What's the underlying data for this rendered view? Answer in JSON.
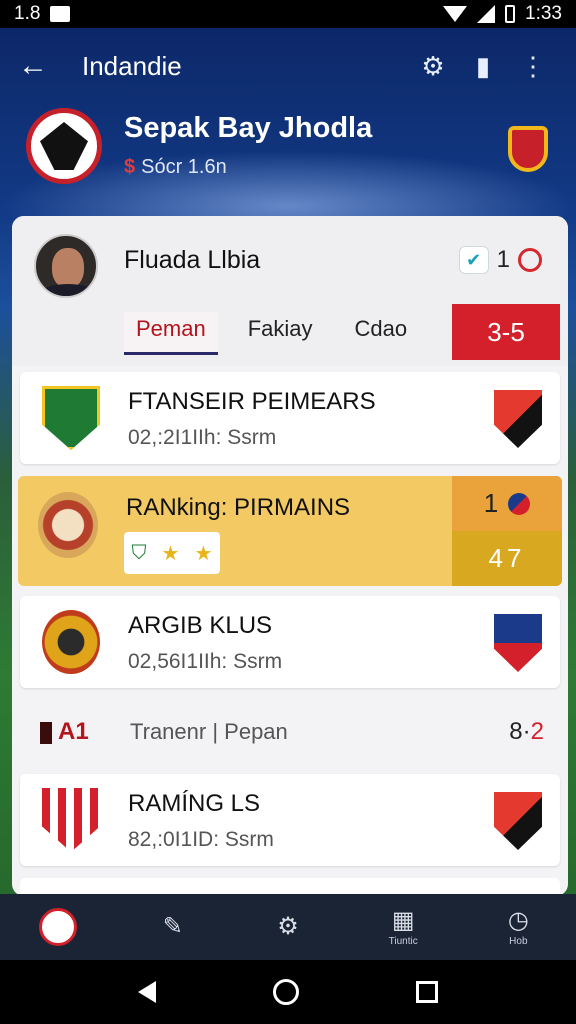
{
  "status_bar": {
    "left_text": "1.8",
    "time": "1:33"
  },
  "app_bar": {
    "title": "Indandie",
    "icons": [
      "back-arrow-icon",
      "gear-icon",
      "cards-icon",
      "more-vert-icon"
    ]
  },
  "club": {
    "name": "Sepak Bay Jhodla",
    "subtitle": "Sócr 1.6n",
    "currency_symbol": "$"
  },
  "profile": {
    "name": "Fluada Llbia",
    "stat_value": "1",
    "tabs": [
      {
        "label": "Peman",
        "active": true
      },
      {
        "label": "Fakiay",
        "active": false
      },
      {
        "label": "Cdao",
        "active": false
      }
    ],
    "score": "3-5"
  },
  "rows": [
    {
      "title": "FTANSEIR PEIMEARS",
      "subtitle": "02,:2I1IIh: Ssrm"
    },
    {
      "title": "ARGIB KLUS",
      "subtitle": "02,56I1IIh: Ssrm"
    },
    {
      "title": "RAMÍNG LS",
      "subtitle": "82,:0I1ID: Ssrm"
    }
  ],
  "ranking": {
    "title": "RANking: PIRMAINS",
    "badges": [
      "shield-icon",
      "star-icon",
      "star-icon"
    ],
    "rank": "1",
    "points": "47"
  },
  "midline": {
    "code": "A1",
    "text": "Tranenr  |  Pepan",
    "score_left": "8·",
    "score_right": "2"
  },
  "bottom_nav": [
    {
      "name": "nav-club",
      "label": ""
    },
    {
      "name": "nav-edit",
      "label": ""
    },
    {
      "name": "nav-settings",
      "label": ""
    },
    {
      "name": "nav-stats",
      "label": "Tiuntic"
    },
    {
      "name": "nav-timer",
      "label": "Hob"
    }
  ],
  "colors": {
    "accent_red": "#d3202a",
    "ranking_yellow": "#f3c963",
    "navy": "#0c2564"
  }
}
